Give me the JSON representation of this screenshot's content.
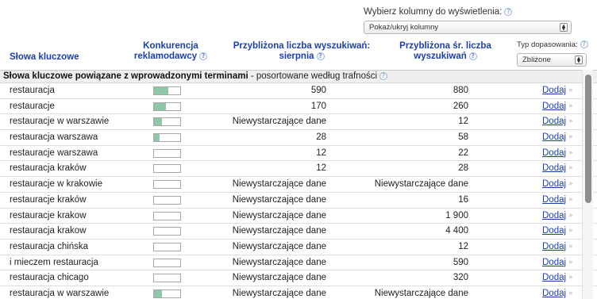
{
  "column_picker": {
    "label": "Wybierz kolumny do wyświetlenia:",
    "help": "?",
    "selected": "Pokaż/ukryj kolumny"
  },
  "header": {
    "keyword": "Słowa kluczowe",
    "competition_line1": "Konkurencja",
    "competition_line2": "reklamodawcy",
    "august_line1": "Przybliżona liczba wyszukiwań:",
    "august_line2": "sierpnia",
    "avg_line1": "Przybliżona śr. liczba",
    "avg_line2": "wyszukiwań",
    "match_type_label": "Typ dopasowania:",
    "match_type_value": "Zbliżone",
    "help": "?"
  },
  "group": {
    "title": "Słowa kluczowe powiązane z wprowadzonymi terminami",
    "subtitle": " - posortowane według trafności",
    "help": "?"
  },
  "rows": [
    {
      "keyword": "restauracja",
      "competition": 0.55,
      "august": "590",
      "avg": "880",
      "add": "Dodaj",
      "chev": "»"
    },
    {
      "keyword": "restauracje",
      "competition": 0.45,
      "august": "170",
      "avg": "260",
      "add": "Dodaj",
      "chev": "»"
    },
    {
      "keyword": "restauracje w warszawie",
      "competition": 0.3,
      "august": "Niewystarczające dane",
      "avg": "12",
      "add": "Dodaj",
      "chev": "»"
    },
    {
      "keyword": "restauracja warszawa",
      "competition": 0.2,
      "august": "28",
      "avg": "58",
      "add": "Dodaj",
      "chev": "»"
    },
    {
      "keyword": "restauracje warszawa",
      "competition": 0.0,
      "august": "12",
      "avg": "22",
      "add": "Dodaj",
      "chev": "»"
    },
    {
      "keyword": "restauracja kraków",
      "competition": 0.0,
      "august": "12",
      "avg": "28",
      "add": "Dodaj",
      "chev": "»"
    },
    {
      "keyword": "restauracje w krakowie",
      "competition": 0.0,
      "august": "Niewystarczające dane",
      "avg": "Niewystarczające dane",
      "add": "Dodaj",
      "chev": "»"
    },
    {
      "keyword": "restauracje kraków",
      "competition": 0.0,
      "august": "Niewystarczające dane",
      "avg": "16",
      "add": "Dodaj",
      "chev": "»"
    },
    {
      "keyword": "restauracje krakow",
      "competition": 0.0,
      "august": "Niewystarczające dane",
      "avg": "1 900",
      "add": "Dodaj",
      "chev": "»"
    },
    {
      "keyword": "restauracja krakow",
      "competition": 0.0,
      "august": "Niewystarczające dane",
      "avg": "4 400",
      "add": "Dodaj",
      "chev": "»"
    },
    {
      "keyword": "restauracja chińska",
      "competition": 0.0,
      "august": "Niewystarczające dane",
      "avg": "12",
      "add": "Dodaj",
      "chev": "»"
    },
    {
      "keyword": "i mieczem restauracja",
      "competition": 0.0,
      "august": "Niewystarczające dane",
      "avg": "590",
      "add": "Dodaj",
      "chev": "»"
    },
    {
      "keyword": "restauracja chicago",
      "competition": 0.0,
      "august": "Niewystarczające dane",
      "avg": "320",
      "add": "Dodaj",
      "chev": "»"
    },
    {
      "keyword": "restauracja w warszawie",
      "competition": 0.3,
      "august": "Niewystarczające dane",
      "avg": "Niewystarczające dane",
      "add": "Dodaj",
      "chev": "»"
    }
  ],
  "colors": {
    "link": "#1a3fb0",
    "competition_fill": "#8fc8a8"
  }
}
